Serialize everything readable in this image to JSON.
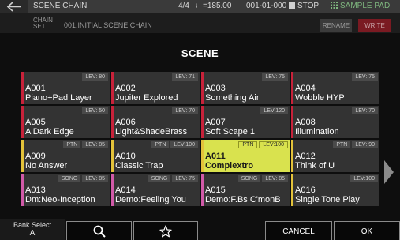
{
  "header": {
    "title": "SCENE CHAIN",
    "measure": "4/4",
    "tempo": "♩=185.00",
    "position": "001-01-000",
    "transport": "STOP",
    "sample_pad": "SAMPLE PAD"
  },
  "subheader": {
    "chain_label_1": "CHAIN",
    "chain_label_2": "SET",
    "chain_value": "001:INITIAL SCENE CHAIN",
    "rename_label": "RENAME",
    "write_label": "WRITE"
  },
  "dialog": {
    "title": "SCENE",
    "cells": [
      {
        "num": "A001",
        "name": "Piano+Pad Layer",
        "badges": [
          "LEV: 80"
        ],
        "stripe": "#c8223a"
      },
      {
        "num": "A002",
        "name": "Jupiter Explored",
        "badges": [
          "LEV: 71"
        ],
        "stripe": "#c8223a"
      },
      {
        "num": "A003",
        "name": "Something Air",
        "badges": [
          "LEV: 75"
        ],
        "stripe": "#c8223a"
      },
      {
        "num": "A004",
        "name": "Wobble HYP",
        "badges": [
          "LEV: 75"
        ],
        "stripe": "#c8223a"
      },
      {
        "num": "A005",
        "name": "A Dark Edge",
        "badges": [
          "LEV: 50"
        ],
        "stripe": "#c8223a"
      },
      {
        "num": "A006",
        "name": "Light&ShadeBrass",
        "badges": [
          "LEV: 70"
        ],
        "stripe": "#c8223a"
      },
      {
        "num": "A007",
        "name": "Soft Scape 1",
        "badges": [
          "LEV:120"
        ],
        "stripe": "#c8223a"
      },
      {
        "num": "A008",
        "name": "Illumination",
        "badges": [
          "LEV: 70"
        ],
        "stripe": "#c8223a"
      },
      {
        "num": "A009",
        "name": "No Answer",
        "badges": [
          "PTN",
          "LEV: 85"
        ],
        "stripe": "#e3c23a"
      },
      {
        "num": "A010",
        "name": "Classic Trap",
        "badges": [
          "PTN",
          "LEV:100"
        ],
        "stripe": "#e3c23a"
      },
      {
        "num": "A011",
        "name": "Complextro",
        "badges": [
          "PTN",
          "LEV:100"
        ],
        "stripe": "#e3c23a"
      },
      {
        "num": "A012",
        "name": "Think of U",
        "badges": [
          "PTN",
          "LEV: 90"
        ],
        "stripe": "#e3c23a"
      },
      {
        "num": "A013",
        "name": "Dm:Neo-Inception",
        "badges": [
          "SONG",
          "LEV: 85"
        ],
        "stripe": "#d15aa8"
      },
      {
        "num": "A014",
        "name": "Demo:Feeling You",
        "badges": [
          "SONG",
          "LEV: 75"
        ],
        "stripe": "#d15aa8"
      },
      {
        "num": "A015",
        "name": "Demo:F.Bs C'monB",
        "badges": [
          "SONG",
          "LEV: 85"
        ],
        "stripe": "#d15aa8"
      },
      {
        "num": "A016",
        "name": "Single Tone Play",
        "badges": [
          "LEV:100"
        ],
        "stripe": "#e3c23a"
      }
    ],
    "selected_index": 10
  },
  "bottom": {
    "bank_label": "Bank Select",
    "bank_value": "A",
    "cancel_label": "CANCEL",
    "ok_label": "OK"
  },
  "colors": {
    "selected": "#d9e24e",
    "cell_bg": "#333333",
    "write": "#7a1a22"
  },
  "icons": [
    "back-arrow-icon",
    "note-icon",
    "stop-icon",
    "grid-icon",
    "search-icon",
    "star-icon",
    "chevron-right-icon"
  ]
}
